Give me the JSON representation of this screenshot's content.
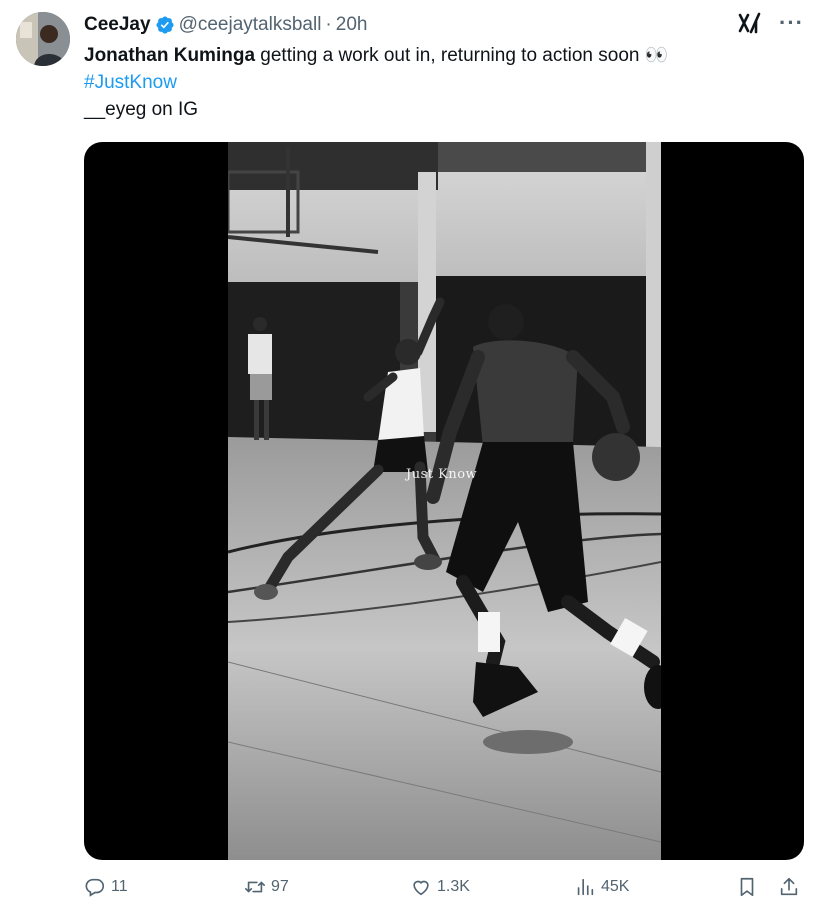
{
  "author": {
    "display_name": "CeeJay",
    "handle": "@ceejaytalksball",
    "time": "20h",
    "separator": "·"
  },
  "tweet": {
    "bold_text": "Jonathan Kuminga",
    "text": " getting a work out in, returning to action soon 👀",
    "hashtag": "#JustKnow",
    "credit": "__eyeg on IG"
  },
  "media": {
    "watermark": "Just Know"
  },
  "actions": {
    "replies": "11",
    "retweets": "97",
    "likes": "1.3K",
    "views": "45K"
  },
  "icons": {
    "verified": "verified-badge-icon",
    "grok": "grok-icon",
    "more": "more-icon",
    "reply": "reply-icon",
    "retweet": "retweet-icon",
    "like": "heart-icon",
    "views": "views-icon",
    "bookmark": "bookmark-icon",
    "share": "share-icon"
  },
  "colors": {
    "link": "#1d9bf0",
    "verified": "#1d9bf0",
    "secondary_text": "#536471",
    "primary_text": "#0f1419"
  }
}
